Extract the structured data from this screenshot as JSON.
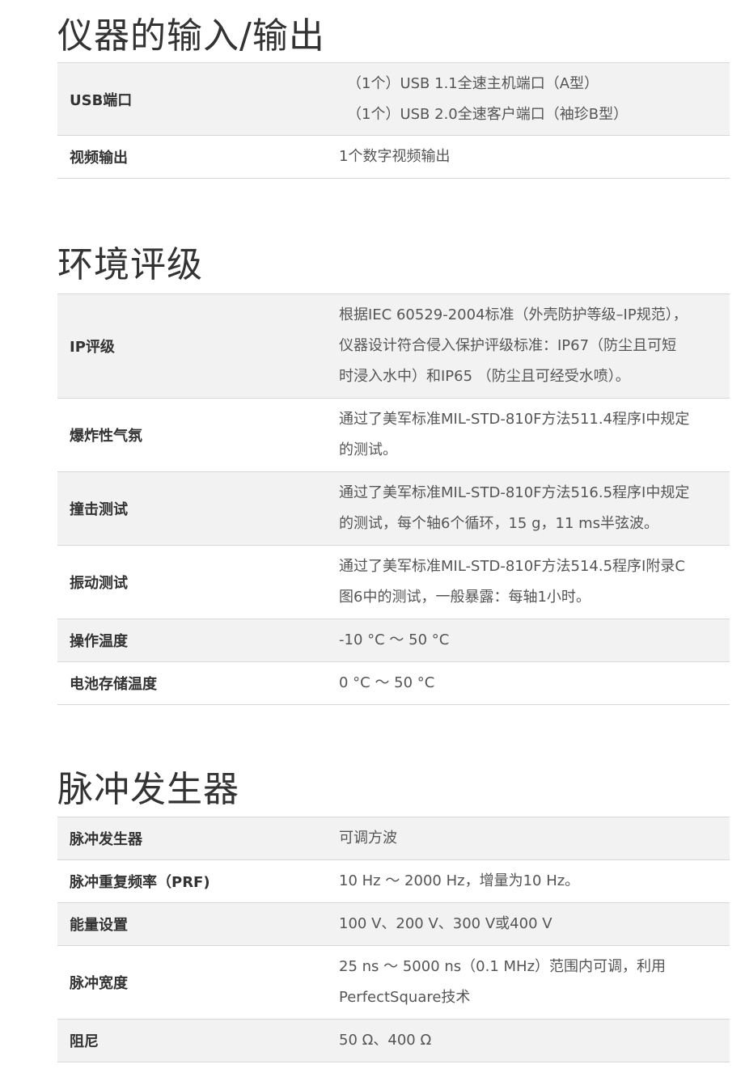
{
  "sections": [
    {
      "title": "仪器的输入/输出",
      "rows": [
        {
          "label": "USB端口",
          "lines": [
            "（1个）USB 1.1全速主机端口（A型）",
            "（1个）USB 2.0全速客户端口（袖珍B型）"
          ]
        },
        {
          "label": "视频输出",
          "lines": [
            "1个数字视频输出"
          ]
        }
      ]
    },
    {
      "title": "环境评级",
      "rows": [
        {
          "label": "IP评级",
          "lines": [
            "根据IEC 60529-2004标准（外壳防护等级–IP规范），",
            "仪器设计符合侵入保护评级标准：IP67（防尘且可短",
            "时浸入水中）和IP65 （防尘且可经受水喷）。"
          ]
        },
        {
          "label": "爆炸性气氛",
          "lines": [
            "通过了美军标准MIL-STD-810F方法511.4程序I中规定",
            "的测试。"
          ]
        },
        {
          "label": "撞击测试",
          "lines": [
            "通过了美军标准MIL-STD-810F方法516.5程序I中规定",
            "的测试，每个轴6个循环，15 g，11 ms半弦波。"
          ]
        },
        {
          "label": "振动测试",
          "lines": [
            "通过了美军标准MIL-STD-810F方法514.5程序I附录C",
            "图6中的测试，一般暴露：每轴1小时。"
          ]
        },
        {
          "label": "操作温度",
          "lines": [
            "-10 °C ～ 50 °C"
          ]
        },
        {
          "label": "电池存储温度",
          "lines": [
            "0 °C ～ 50 °C"
          ]
        }
      ]
    },
    {
      "title": "脉冲发生器",
      "rows": [
        {
          "label": "脉冲发生器",
          "lines": [
            "可调方波"
          ]
        },
        {
          "label": "脉冲重复频率（PRF)",
          "lines": [
            "10 Hz ～ 2000 Hz，增量为10 Hz。"
          ]
        },
        {
          "label": "能量设置",
          "lines": [
            "100 V、200 V、300 V或400 V"
          ]
        },
        {
          "label": "脉冲宽度",
          "lines": [
            "25 ns ～ 5000 ns（0.1 MHz）范围内可调，利用",
            "PerfectSquare技术"
          ]
        },
        {
          "label": "阻尼",
          "lines": [
            "50 Ω、400 Ω"
          ]
        }
      ]
    }
  ]
}
